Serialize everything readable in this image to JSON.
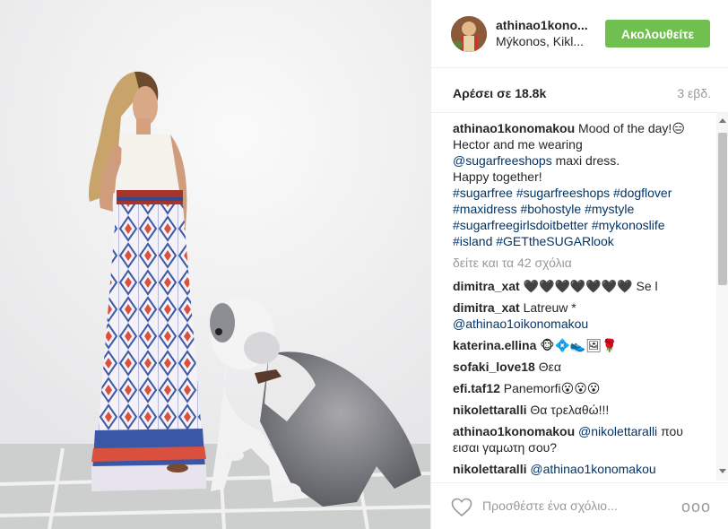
{
  "post": {
    "username": "athinao1kono...",
    "location": "Mýkonos, Kikl...",
    "follow_label": "Ακολουθείτε",
    "likes": "Αρέσει σε 18.8k",
    "time": "3 εβδ."
  },
  "caption": {
    "user": "athinao1konomakou",
    "line1": " Mood of the day!😑",
    "line2": "Hector and me wearing",
    "mention": "@sugarfreeshops",
    "line3": " maxi dress.",
    "line4": "Happy together!",
    "hashtags_1": "#sugarfree #sugarfreeshops #dogflover",
    "hashtags_2": "#maxidress #bohostyle #mystyle",
    "hashtags_3": "#sugarfreegirlsdoitbetter #mykonoslife",
    "hashtags_4": "#island #GETtheSUGARlook"
  },
  "view_all": "δείτε και τα 42 σχόλια",
  "comments": [
    {
      "user": "dimitra_xat",
      "text": " 🖤🖤🖤🖤🖤🖤🖤 Se l"
    },
    {
      "user": "dimitra_xat",
      "text": " Latreuw *",
      "mention": "@athinao1oikonomakou"
    },
    {
      "user": "katerina.ellina",
      "text": " 🐵💠👟🖼🌹"
    },
    {
      "user": "sofaki_love18",
      "text": " Θεα"
    },
    {
      "user": "efi.taf12",
      "text": " Panemorfi😮😮😮"
    },
    {
      "user": "nikolettaralli",
      "text": " Θα τρελαθώ!!!"
    },
    {
      "user": "athinao1konomakou",
      "mention": " @nikolettaralli",
      "text": " που εισαι γαμωτη σου?"
    },
    {
      "user": "nikolettaralli",
      "mention": " @athinao1konomakou",
      "text": ""
    }
  ],
  "footer": {
    "placeholder": "Προσθέστε ένα σχόλιο...",
    "options": "ooo"
  },
  "colors": {
    "follow_button": "#70c050",
    "link": "#003569",
    "muted": "#999999"
  }
}
